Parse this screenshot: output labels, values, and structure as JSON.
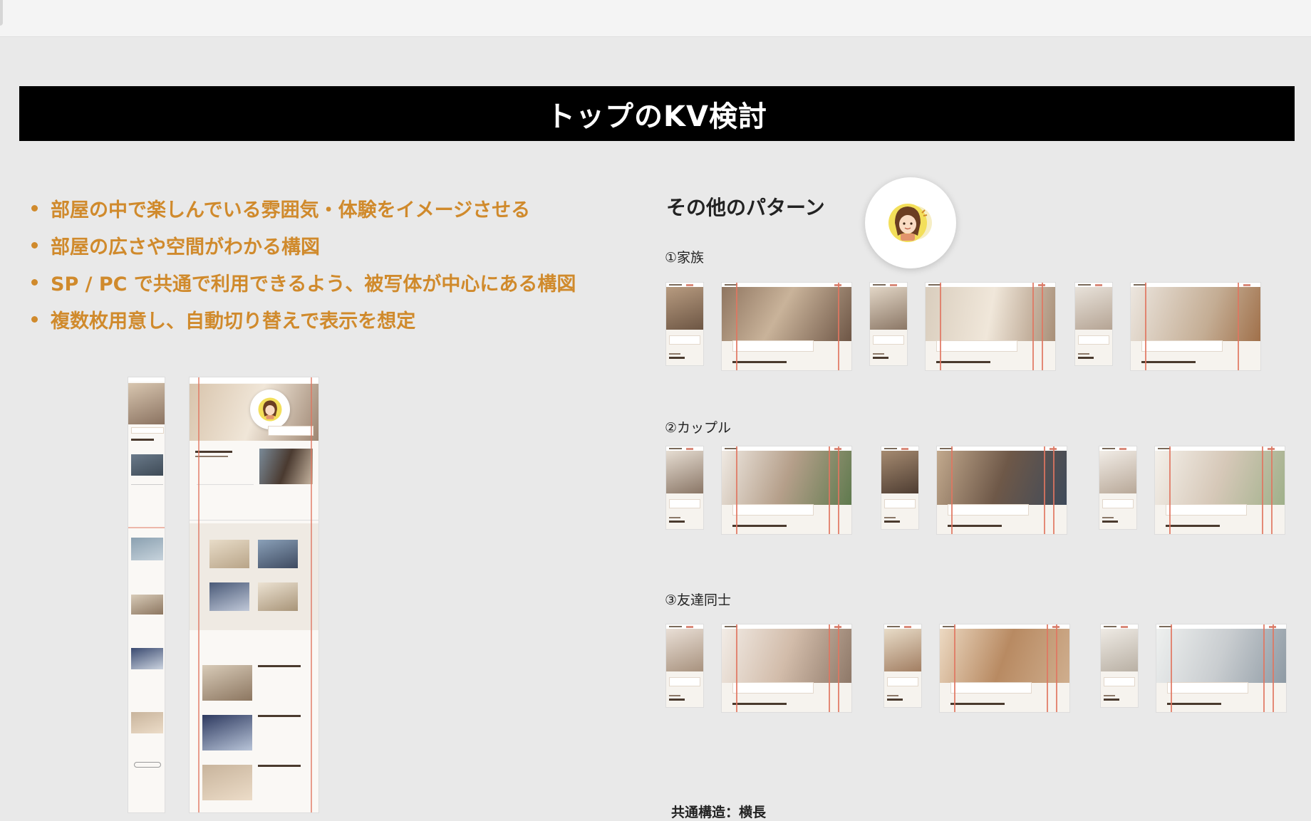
{
  "banner": {
    "title": "トップのKV検討"
  },
  "bullets": [
    "部屋の中で楽しんでいる雰囲気・体験をイメージさせる",
    "部屋の広さや空間がわかる構図",
    "SP / PC で共通で利用できるよう、被写体が中心にある構図",
    "複数枚用意し、自動切り替えで表示を想定"
  ],
  "patterns": {
    "title": "その他のパターン",
    "sections": [
      {
        "label": "①家族"
      },
      {
        "label": "②カップル"
      },
      {
        "label": "③友達同士"
      }
    ],
    "bottom_label": "共通構造：横長"
  },
  "colors": {
    "accent": "#d08a2c",
    "banner_bg": "#000000",
    "guide": "#e07560",
    "canvas_bg": "#e9e9e9"
  },
  "icons": {
    "avatar": "character-avatar-icon"
  }
}
